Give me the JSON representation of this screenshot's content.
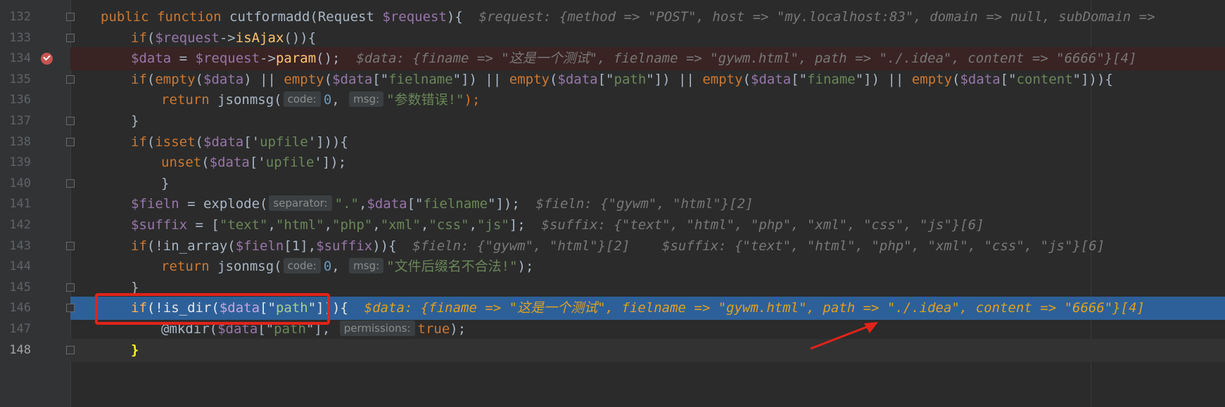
{
  "editor": {
    "lines": [
      {
        "number": "132",
        "parts": [
          [
            "kw",
            "public function "
          ],
          [
            "call",
            "cutformadd"
          ],
          [
            "call",
            "(Request "
          ],
          [
            "var",
            "$request"
          ],
          [
            "call",
            "){"
          ],
          [
            "inline",
            "  $request: {method => \"POST\", host => \"my.localhost:83\", domain => null, subDomain =>"
          ]
        ],
        "indent": 0,
        "state": "normal",
        "fold": true
      },
      {
        "number": "133",
        "parts": [
          [
            "kw",
            "if"
          ],
          [
            "call",
            "("
          ],
          [
            "var",
            "$request"
          ],
          [
            "call",
            "->"
          ],
          [
            "fn",
            "isAjax"
          ],
          [
            "call",
            "()){"
          ]
        ],
        "indent": 1,
        "state": "normal",
        "fold": true
      },
      {
        "number": "134",
        "parts": [
          [
            "var",
            "$data"
          ],
          [
            "call",
            " = "
          ],
          [
            "var",
            "$request"
          ],
          [
            "call",
            "->"
          ],
          [
            "fn",
            "param"
          ],
          [
            "call",
            "();"
          ],
          [
            "inline",
            "  $data: {finame => \"这是一个测试\", fielname => \"gywm.html\", path => \"./.idea\", content => \"6666\"}[4]"
          ]
        ],
        "indent": 1,
        "state": "bp",
        "fold": false
      },
      {
        "number": "135",
        "parts": [
          [
            "kw",
            "if"
          ],
          [
            "call",
            "("
          ],
          [
            "kw",
            "empty"
          ],
          [
            "call",
            "("
          ],
          [
            "var",
            "$data"
          ],
          [
            "call",
            ") || "
          ],
          [
            "kw",
            "empty"
          ],
          [
            "call",
            "("
          ],
          [
            "var",
            "$data"
          ],
          [
            "call",
            "[\""
          ],
          [
            "str",
            "fielname"
          ],
          [
            "call",
            "\"]) || "
          ],
          [
            "kw",
            "empty"
          ],
          [
            "call",
            "("
          ],
          [
            "var",
            "$data"
          ],
          [
            "call",
            "[\""
          ],
          [
            "str",
            "path"
          ],
          [
            "call",
            "\"]) || "
          ],
          [
            "kw",
            "empty"
          ],
          [
            "call",
            "("
          ],
          [
            "var",
            "$data"
          ],
          [
            "call",
            "[\""
          ],
          [
            "str",
            "finame"
          ],
          [
            "call",
            "\"]) || "
          ],
          [
            "kw",
            "empty"
          ],
          [
            "call",
            "("
          ],
          [
            "var",
            "$data"
          ],
          [
            "call",
            "[\""
          ],
          [
            "str",
            "content"
          ],
          [
            "call",
            "\"])){"
          ]
        ],
        "indent": 1,
        "state": "normal",
        "fold": true
      },
      {
        "number": "136",
        "parts": [
          [
            "kw",
            "return "
          ],
          [
            "call",
            "jsonmsg("
          ],
          [
            "hint",
            "code:"
          ],
          [
            "num",
            "0"
          ],
          [
            "call",
            ", "
          ],
          [
            "hint",
            "msg:"
          ],
          [
            "str",
            "\"参数错误!\""
          ],
          [
            "kw",
            ");"
          ]
        ],
        "indent": 2,
        "state": "normal",
        "fold": false
      },
      {
        "number": "137",
        "parts": [
          [
            "call",
            "}"
          ]
        ],
        "indent": 1,
        "state": "normal",
        "fold": true
      },
      {
        "number": "138",
        "parts": [
          [
            "kw",
            "if"
          ],
          [
            "call",
            "("
          ],
          [
            "kw",
            "isset"
          ],
          [
            "call",
            "("
          ],
          [
            "var",
            "$data"
          ],
          [
            "call",
            "['"
          ],
          [
            "str",
            "upfile"
          ],
          [
            "call",
            "'])){"
          ]
        ],
        "indent": 1,
        "state": "normal",
        "fold": true
      },
      {
        "number": "139",
        "parts": [
          [
            "kw",
            "unset"
          ],
          [
            "call",
            "("
          ],
          [
            "var",
            "$data"
          ],
          [
            "call",
            "['"
          ],
          [
            "str",
            "upfile"
          ],
          [
            "call",
            "']);"
          ]
        ],
        "indent": 2,
        "state": "normal",
        "fold": false
      },
      {
        "number": "140",
        "parts": [
          [
            "call",
            "}"
          ]
        ],
        "indent": 2,
        "state": "normal",
        "fold": true
      },
      {
        "number": "141",
        "parts": [
          [
            "var",
            "$fieln"
          ],
          [
            "call",
            " = explode("
          ],
          [
            "hint",
            "separator:"
          ],
          [
            "str",
            "\".\""
          ],
          [
            "call",
            ","
          ],
          [
            "var",
            "$data"
          ],
          [
            "call",
            "[\""
          ],
          [
            "str",
            "fielname"
          ],
          [
            "call",
            "\"]);"
          ],
          [
            "inline",
            "  $fieln: {\"gywm\", \"html\"}[2]"
          ]
        ],
        "indent": 1,
        "state": "normal",
        "fold": false
      },
      {
        "number": "142",
        "parts": [
          [
            "var",
            "$suffix"
          ],
          [
            "call",
            " = ["
          ],
          [
            "str",
            "\"text\""
          ],
          [
            "call",
            ","
          ],
          [
            "str",
            "\"html\""
          ],
          [
            "call",
            ","
          ],
          [
            "str",
            "\"php\""
          ],
          [
            "call",
            ","
          ],
          [
            "str",
            "\"xml\""
          ],
          [
            "call",
            ","
          ],
          [
            "str",
            "\"css\""
          ],
          [
            "call",
            ","
          ],
          [
            "str",
            "\"js\""
          ],
          [
            "call",
            "];"
          ],
          [
            "inline",
            "  $suffix: {\"text\", \"html\", \"php\", \"xml\", \"css\", \"js\"}[6]"
          ]
        ],
        "indent": 1,
        "state": "normal",
        "fold": false
      },
      {
        "number": "143",
        "parts": [
          [
            "kw",
            "if"
          ],
          [
            "call",
            "(!in_array("
          ],
          [
            "var",
            "$fieln"
          ],
          [
            "call",
            "[1],"
          ],
          [
            "var",
            "$suffix"
          ],
          [
            "call",
            ")){"
          ],
          [
            "inline",
            "  $fieln: {\"gywm\", \"html\"}[2]    $suffix: {\"text\", \"html\", \"php\", \"xml\", \"css\", \"js\"}[6]"
          ]
        ],
        "indent": 1,
        "state": "normal",
        "fold": true
      },
      {
        "number": "144",
        "parts": [
          [
            "kw",
            "return "
          ],
          [
            "call",
            "jsonmsg("
          ],
          [
            "hint",
            "code:"
          ],
          [
            "num",
            "0"
          ],
          [
            "call",
            ", "
          ],
          [
            "hint",
            "msg:"
          ],
          [
            "str",
            "\"文件后缀名不合法!\""
          ],
          [
            "call",
            ");"
          ]
        ],
        "indent": 2,
        "state": "normal",
        "fold": false
      },
      {
        "number": "145",
        "parts": [
          [
            "call",
            "}"
          ]
        ],
        "indent": 1,
        "state": "normal",
        "fold": true
      },
      {
        "number": "146",
        "parts": [
          [
            "kw",
            "if"
          ],
          [
            "call",
            "(!is_dir("
          ],
          [
            "var",
            "$data"
          ],
          [
            "call",
            "[\""
          ],
          [
            "str",
            "path"
          ],
          [
            "call",
            "\"])){"
          ],
          [
            "inline",
            "  $data: {finame => \"这是一个测试\", fielname => \"gywm.html\", path => \"./.idea\", content => \"6666\"}[4]"
          ]
        ],
        "indent": 1,
        "state": "cur",
        "fold": true
      },
      {
        "number": "147",
        "parts": [
          [
            "call",
            "@mkdir("
          ],
          [
            "var",
            "$data"
          ],
          [
            "call",
            "[\""
          ],
          [
            "str",
            "path"
          ],
          [
            "call",
            "\"], "
          ],
          [
            "hint",
            "permissions:"
          ],
          [
            "kw",
            "true"
          ],
          [
            "call",
            ");"
          ]
        ],
        "indent": 2,
        "state": "normal",
        "fold": false
      },
      {
        "number": "148",
        "parts": [
          [
            "brace",
            "}"
          ]
        ],
        "indent": 1,
        "state": "caret",
        "fold": true
      }
    ]
  },
  "colors": {
    "background": "#2b2b2b",
    "current_line": "#2d6099",
    "breakpoint_line": "#3a2323",
    "highlight_box": "#e2231a",
    "arrow": "#e2231a"
  },
  "icons": {
    "breakpoint": "breakpoint-check-icon",
    "fold": "fold-marker-icon",
    "arrow": "annotation-arrow-icon"
  }
}
